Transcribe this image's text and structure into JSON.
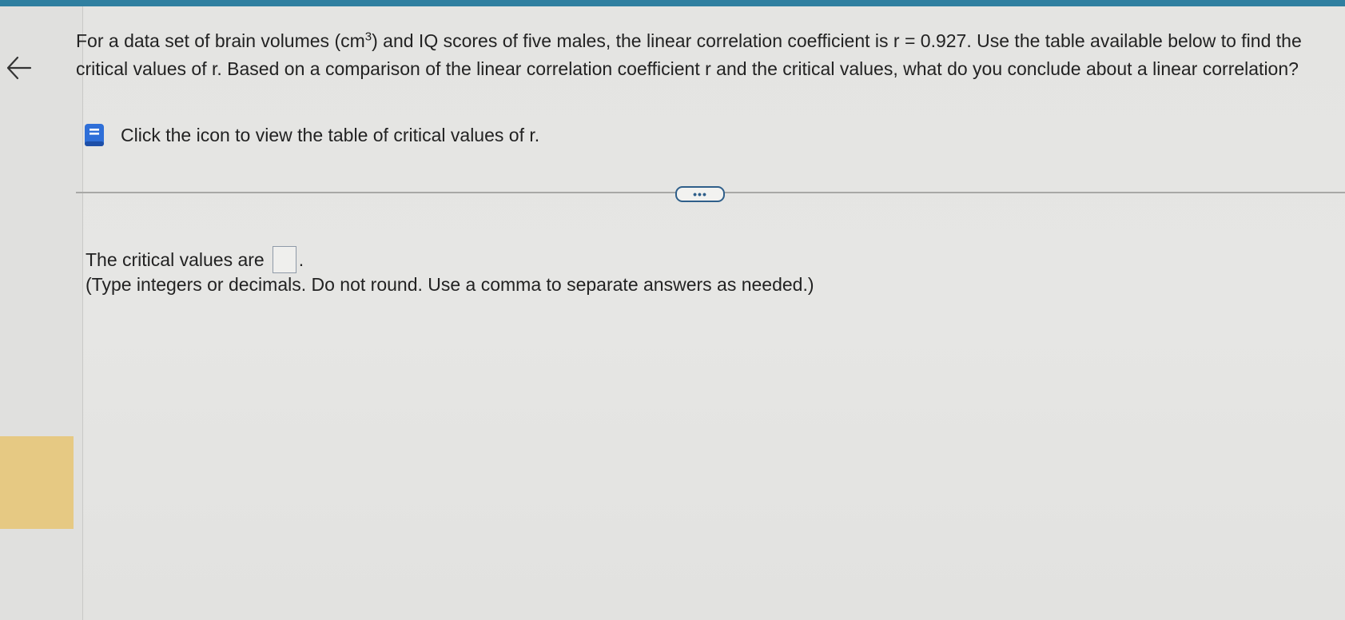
{
  "question": {
    "text_before_sup": "For a data set of brain volumes (cm",
    "superscript": "3",
    "text_after_sup": ") and IQ scores of five males, the linear correlation coefficient is r = 0.927. Use the table available below to find the critical values of r. Based on a comparison of the linear correlation coefficient r and the critical values, what do you conclude about a linear correlation?"
  },
  "hint": {
    "label": "Click the icon to view the table of critical values of r.",
    "icon": "book-icon"
  },
  "more_button": {
    "label": "•••"
  },
  "answer": {
    "prefix": "The critical values are",
    "value": "",
    "suffix": ".",
    "instructions": "(Type integers or decimals. Do not round. Use a comma to separate answers as needed.)"
  },
  "colors": {
    "top_bar": "#2f7fa0",
    "highlight": "#e6c983",
    "button_border": "#2f5f8a"
  }
}
